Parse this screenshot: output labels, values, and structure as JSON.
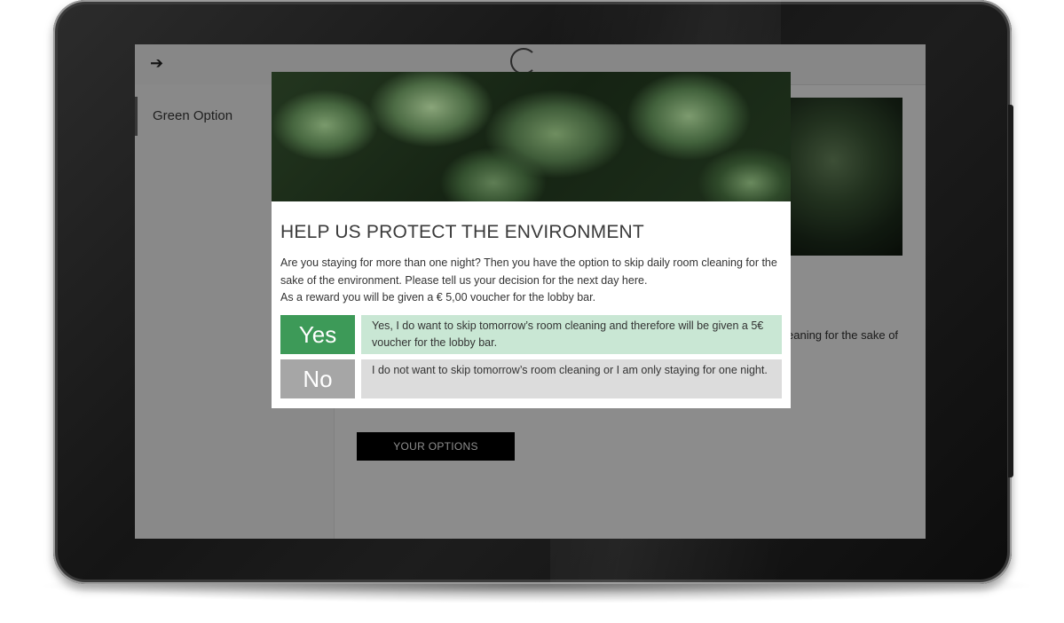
{
  "app": {
    "sidebar": {
      "items": [
        {
          "label": "Green Option"
        }
      ]
    },
    "main": {
      "body_text_fragment": "eaning for the sake of",
      "options_button_label": "YOUR OPTIONS"
    }
  },
  "modal": {
    "title": "HELP US PROTECT THE ENVIRONMENT",
    "description_line1": "Are you staying for more than one night? Then you have the option to skip daily room cleaning for the sake of the environment. Please tell us your decision for the next day here.",
    "description_line2": "As a reward you will be given a € 5,00 voucher for the lobby bar.",
    "options": {
      "yes": {
        "button_label": "Yes",
        "text": "Yes, I do want to skip tomorrow’s room cleaning and therefore will be given a 5€ voucher for the lobby bar."
      },
      "no": {
        "button_label": "No",
        "text": "I do not want to skip tomorrow’s room cleaning or I am only staying for one night."
      }
    }
  },
  "colors": {
    "yes_button": "#3d9a58",
    "yes_text_bg": "#c9e7d4",
    "no_button": "#a6a6a6",
    "no_text_bg": "#dcdcdc",
    "overlay": "rgba(0,0,0,0.45)"
  },
  "icons": {
    "back": "arrow-left-icon",
    "loading": "spinner-icon"
  }
}
